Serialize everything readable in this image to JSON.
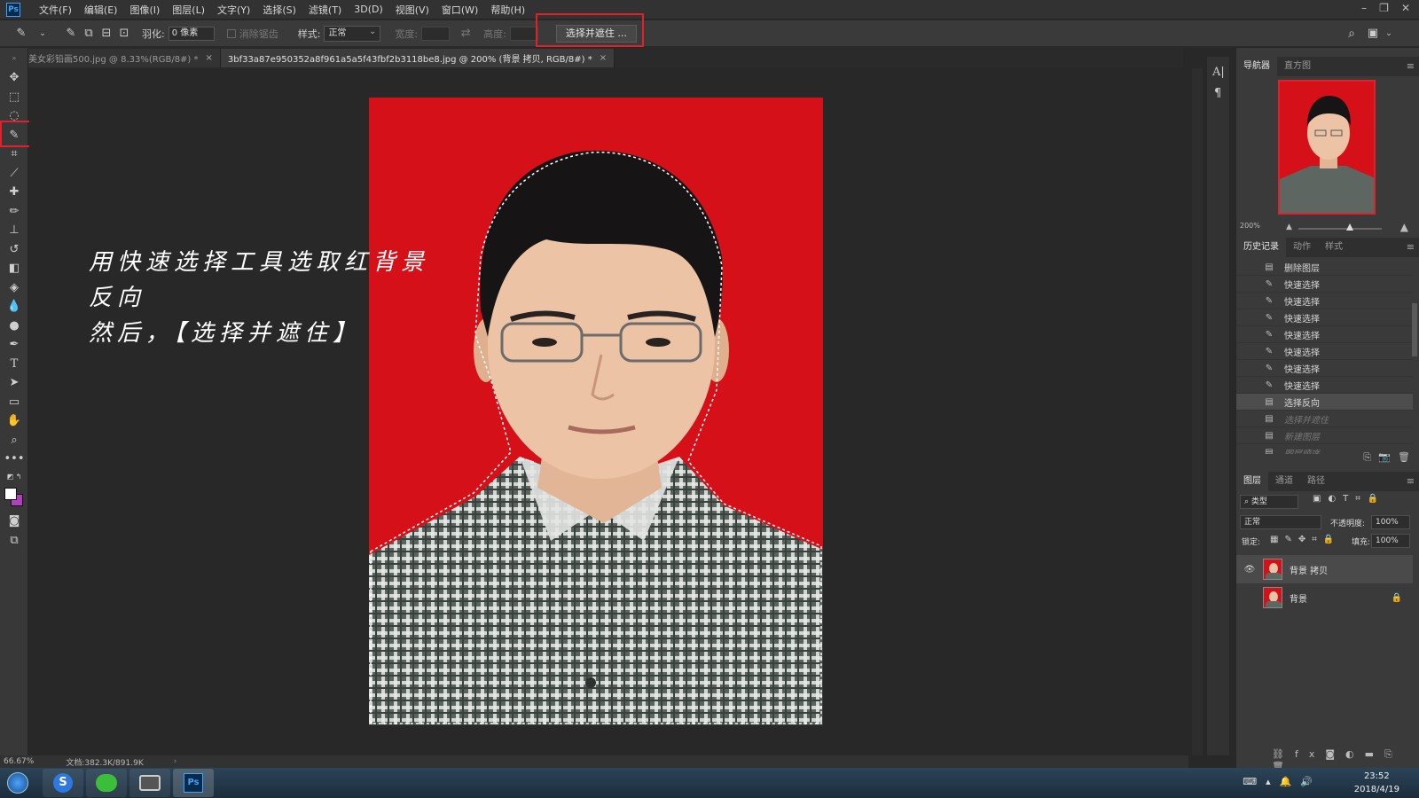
{
  "app": {
    "logo": "Ps"
  },
  "menu": [
    "文件(F)",
    "编辑(E)",
    "图像(I)",
    "图层(L)",
    "文字(Y)",
    "选择(S)",
    "滤镜(T)",
    "3D(D)",
    "视图(V)",
    "窗口(W)",
    "帮助(H)"
  ],
  "options": {
    "feather_label": "羽化:",
    "feather_value": "0 像素",
    "antialias_label": "消除锯齿",
    "style_label": "样式:",
    "style_value": "正常",
    "width_label": "宽度:",
    "height_label": "高度:",
    "select_mask_button": "选择并遮住 ..."
  },
  "tabs": [
    {
      "label": "美女彩铅画500.jpg @ 8.33%(RGB/8#) *",
      "close": "×"
    },
    {
      "label": "3bf33a87e950352a8f961a5a5f43fbf2b3118be8.jpg @ 200% (背景 拷贝, RGB/8#) *",
      "close": "×"
    }
  ],
  "annotation": {
    "line1": "用快速选择工具选取红背景",
    "line2": "反向",
    "line3": "然后，【选择并遮住】"
  },
  "status": {
    "zoom": "66.67%",
    "doc": "文档:382.3K/891.9K"
  },
  "navigator": {
    "tab1": "导航器",
    "tab2": "直方图",
    "zoom": "200%"
  },
  "history": {
    "tab1": "历史记录",
    "tab2": "动作",
    "tab3": "样式",
    "items": [
      {
        "label": "删除图层",
        "icon": "document-icon",
        "state": "normal"
      },
      {
        "label": "快速选择",
        "icon": "quick-select-icon",
        "state": "normal"
      },
      {
        "label": "快速选择",
        "icon": "quick-select-icon",
        "state": "normal"
      },
      {
        "label": "快速选择",
        "icon": "quick-select-icon",
        "state": "normal"
      },
      {
        "label": "快速选择",
        "icon": "quick-select-icon",
        "state": "normal"
      },
      {
        "label": "快速选择",
        "icon": "quick-select-icon",
        "state": "normal"
      },
      {
        "label": "快速选择",
        "icon": "quick-select-icon",
        "state": "normal"
      },
      {
        "label": "快速选择",
        "icon": "quick-select-icon",
        "state": "normal"
      },
      {
        "label": "选择反向",
        "icon": "document-icon",
        "state": "selected"
      },
      {
        "label": "选择并遮住",
        "icon": "document-icon",
        "state": "dimmed"
      },
      {
        "label": "新建图层",
        "icon": "document-icon",
        "state": "dimmed"
      },
      {
        "label": "图层顺序",
        "icon": "document-icon",
        "state": "dimmed"
      }
    ]
  },
  "layers": {
    "tab1": "图层",
    "tab2": "通道",
    "tab3": "路径",
    "filter_kind": "类型",
    "blend_mode": "正常",
    "opacity_label": "不透明度:",
    "opacity_value": "100%",
    "lock_label": "锁定:",
    "fill_label": "填充:",
    "fill_value": "100%",
    "items": [
      {
        "name": "背景 拷贝",
        "visible": true,
        "selected": true
      },
      {
        "name": "背景",
        "visible": false,
        "selected": false,
        "locked": true
      }
    ]
  },
  "taskbar": {
    "time": "23:52",
    "date": "2018/4/19"
  },
  "colors": {
    "background_red": "#d51018",
    "highlight_red": "#e0202a",
    "panel": "#3a3a3a"
  }
}
